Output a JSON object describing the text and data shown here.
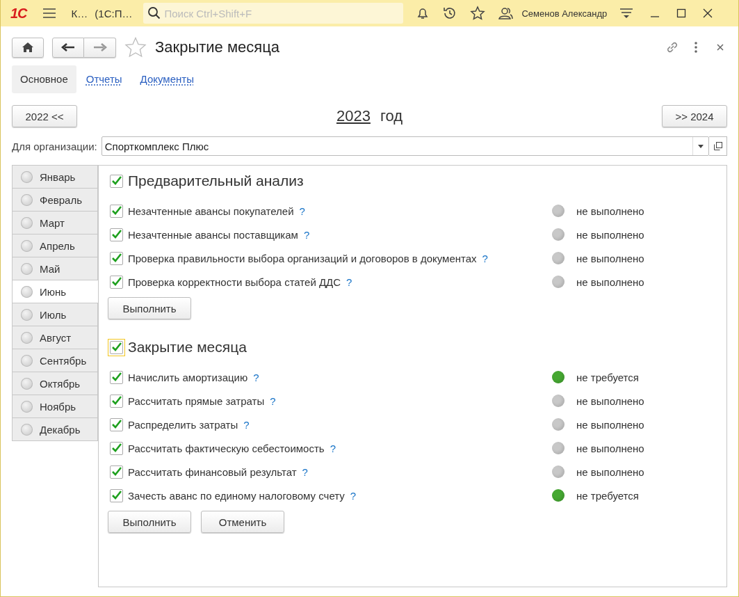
{
  "titlebar": {
    "logo": "1С",
    "app_title": "К…",
    "config_title": "(1С:П…",
    "search": {
      "placeholder": "Поиск Ctrl+Shift+F"
    },
    "user": "Семенов Александр"
  },
  "form": {
    "title": "Закрытие месяца",
    "favorite": false
  },
  "tabs": [
    {
      "label": "Основное",
      "selected": true
    },
    {
      "label": "Отчеты",
      "selected": false
    },
    {
      "label": "Документы",
      "selected": false
    }
  ],
  "year_nav": {
    "prev": "2022 <<",
    "year": "2023",
    "year_word": "год",
    "next": ">> 2024"
  },
  "organization": {
    "label": "Для организации:",
    "value": "Спорткомплекс Плюс"
  },
  "months": [
    {
      "label": "Январь",
      "selected": false
    },
    {
      "label": "Февраль",
      "selected": false
    },
    {
      "label": "Март",
      "selected": false
    },
    {
      "label": "Апрель",
      "selected": false
    },
    {
      "label": "Май",
      "selected": false
    },
    {
      "label": "Июнь",
      "selected": true
    },
    {
      "label": "Июль",
      "selected": false
    },
    {
      "label": "Август",
      "selected": false
    },
    {
      "label": "Сентябрь",
      "selected": false
    },
    {
      "label": "Октябрь",
      "selected": false
    },
    {
      "label": "Ноябрь",
      "selected": false
    },
    {
      "label": "Декабрь",
      "selected": false
    }
  ],
  "sections": [
    {
      "title": "Предварительный анализ",
      "checked": true,
      "focused": false,
      "items": [
        {
          "label": "Незачтенные авансы покупателей",
          "help": "?",
          "checked": true,
          "status": "не выполнено",
          "color": "#c8c8c8"
        },
        {
          "label": "Незачтенные авансы поставщикам",
          "help": "?",
          "checked": true,
          "status": "не выполнено",
          "color": "#c8c8c8"
        },
        {
          "label": "Проверка правильности выбора организаций и договоров в документах",
          "help": "?",
          "checked": true,
          "status": "не выполнено",
          "color": "#c8c8c8"
        },
        {
          "label": "Проверка корректности выбора статей ДДС",
          "help": "?",
          "checked": true,
          "status": "не выполнено",
          "color": "#c8c8c8"
        }
      ],
      "buttons": [
        "Выполнить"
      ]
    },
    {
      "title": "Закрытие месяца",
      "checked": true,
      "focused": true,
      "items": [
        {
          "label": "Начислить амортизацию",
          "help": "?",
          "checked": true,
          "status": "не требуется",
          "color": "#46a832"
        },
        {
          "label": "Рассчитать прямые затраты",
          "help": "?",
          "checked": true,
          "status": "не выполнено",
          "color": "#c8c8c8"
        },
        {
          "label": "Распределить затраты",
          "help": "?",
          "checked": true,
          "status": "не выполнено",
          "color": "#c8c8c8"
        },
        {
          "label": "Рассчитать фактическую себестоимость",
          "help": "?",
          "checked": true,
          "status": "не выполнено",
          "color": "#c8c8c8"
        },
        {
          "label": "Рассчитать финансовый результат",
          "help": "?",
          "checked": true,
          "status": "не выполнено",
          "color": "#c8c8c8"
        },
        {
          "label": "Зачесть аванс по единому налоговому счету",
          "help": "?",
          "checked": true,
          "status": "не требуется",
          "color": "#46a832"
        }
      ],
      "buttons": [
        "Выполнить",
        "Отменить"
      ]
    }
  ]
}
